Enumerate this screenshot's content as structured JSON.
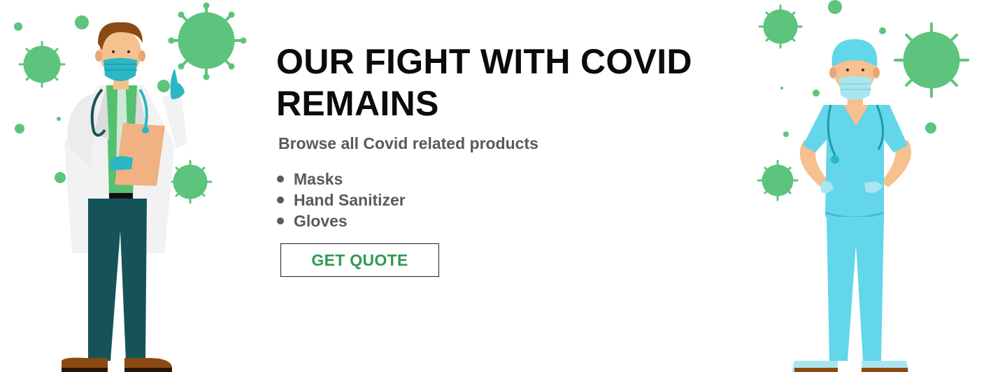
{
  "banner": {
    "headline": "OUR FIGHT WITH COVID REMAINS",
    "subtitle": "Browse all Covid related products",
    "products": [
      "Masks",
      "Hand Sanitizer",
      "Gloves"
    ],
    "cta_label": "GET QUOTE"
  },
  "colors": {
    "virus_green": "#5cc47c",
    "cta_text": "#2f9a52",
    "doctor_coat": "#f2f2f2",
    "scrubs": "#63d6ea",
    "pants": "#165358"
  },
  "icons": [
    "coronavirus-icon",
    "doctor-illustration",
    "nurse-illustration"
  ]
}
